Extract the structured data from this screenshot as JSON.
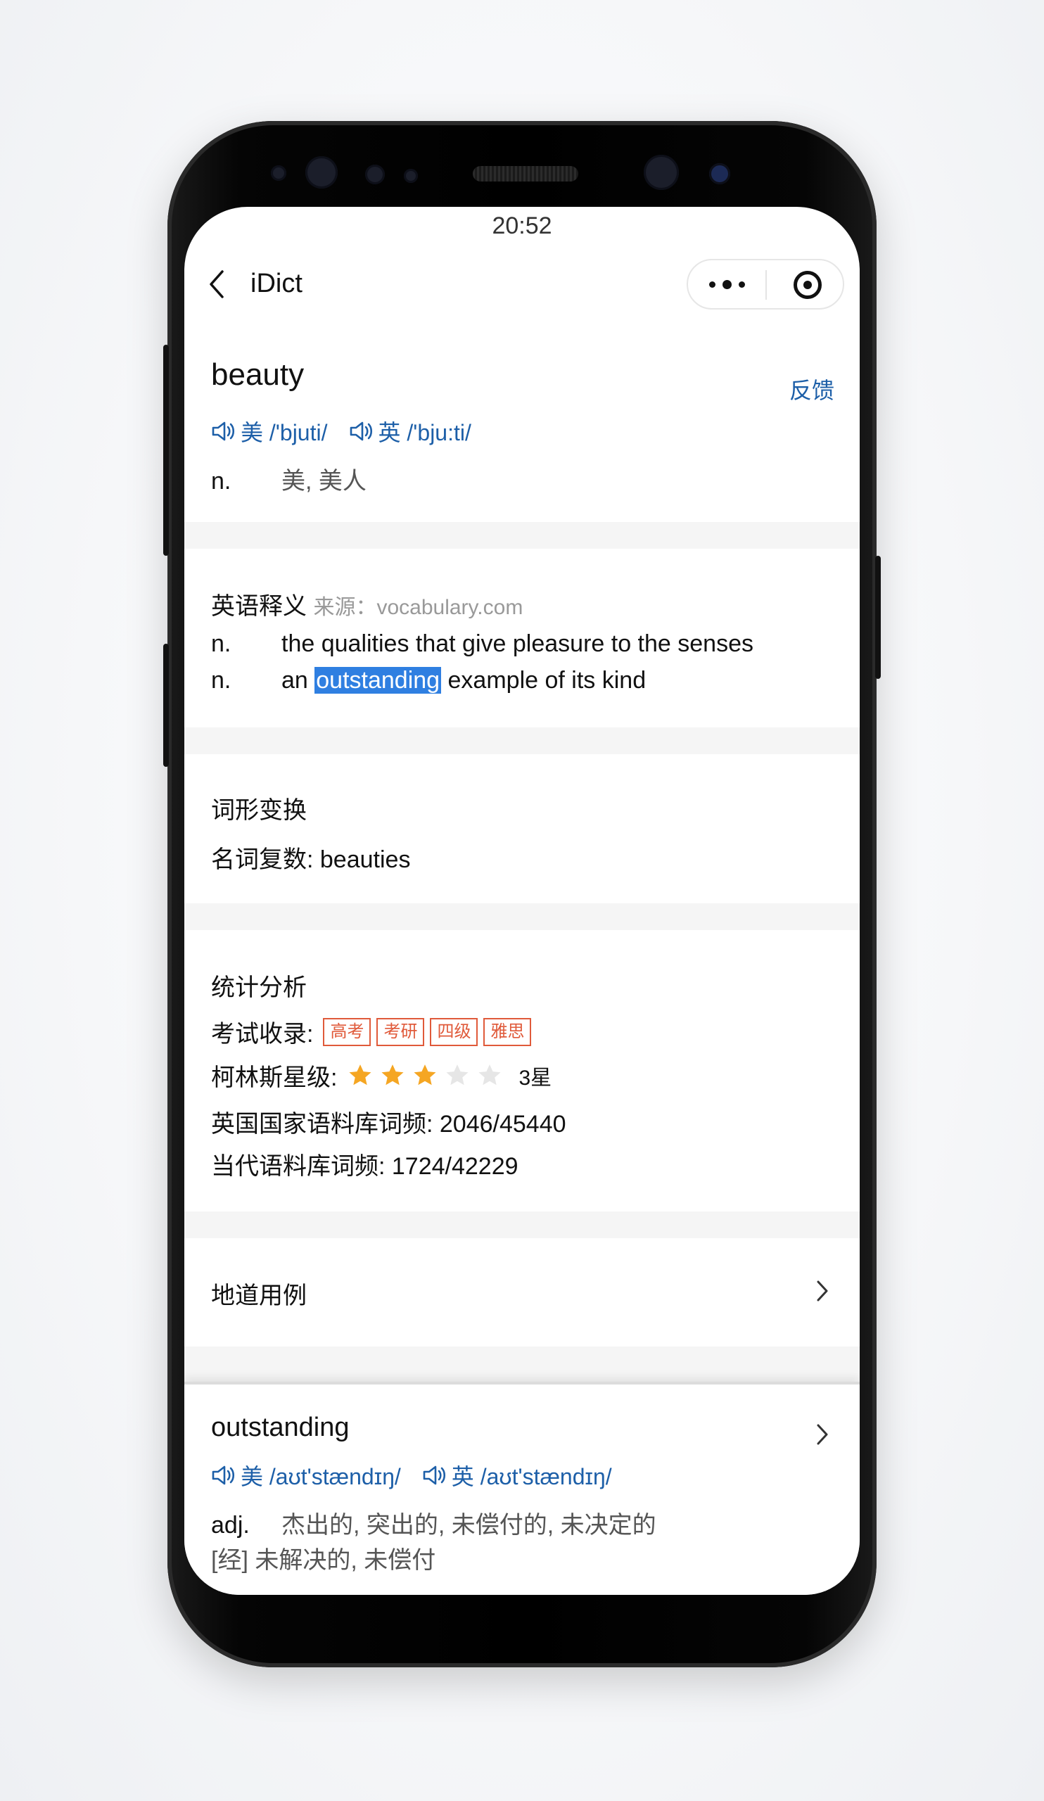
{
  "status": {
    "time": "20:52"
  },
  "nav": {
    "title": "iDict"
  },
  "word": {
    "headword": "beauty",
    "feedback": "反馈",
    "us_label": "美 /'bjuti/",
    "uk_label": "英 /'bju:ti/",
    "pos": "n.",
    "meaning": "美, 美人"
  },
  "english_def": {
    "title": "英语释义",
    "source": "来源：vocabulary.com",
    "rows": [
      {
        "pos": "n.",
        "text": "the qualities that give pleasure to the senses"
      },
      {
        "pos": "n.",
        "before": "an ",
        "highlight": "outstanding",
        "after": " example of its kind"
      }
    ]
  },
  "inflection": {
    "title": "词形变换",
    "plural": "名词复数: beauties"
  },
  "stats": {
    "title": "统计分析",
    "exam_label": "考试收录:",
    "exam_tags": [
      "高考",
      "考研",
      "四级",
      "雅思"
    ],
    "collins_label": "柯林斯星级:",
    "collins_stars": 3,
    "collins_max": 5,
    "collins_text": "3星",
    "bnc": "英国国家语料库词频: 2046/45440",
    "coca": "当代语料库词频: 1724/42229",
    "star_on": "#f5a623",
    "star_off": "#e6e6e6"
  },
  "examples": {
    "title": "地道用例"
  },
  "lookup": {
    "headword": "outstanding",
    "us_label": "美 /aʊt'stændɪŋ/",
    "uk_label": "英 /aʊt'stændɪŋ/",
    "pos": "adj.",
    "meaning": "杰出的, 突出的, 未偿付的, 未决定的",
    "econ": "[经] 未解决的, 未偿付"
  },
  "colors": {
    "link": "#1d5fa8",
    "tag": "#e05a3a",
    "highlight": "#2f7fe1"
  }
}
